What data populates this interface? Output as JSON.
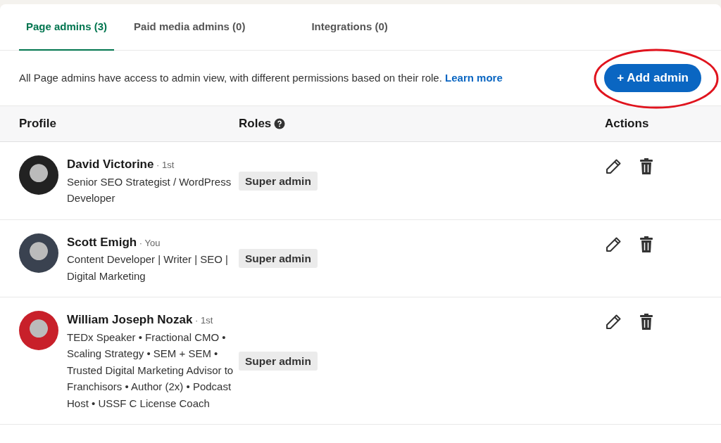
{
  "tabs": [
    {
      "label": "Page admins (3)",
      "selected": true
    },
    {
      "label": "Paid media admins (0)",
      "selected": false
    },
    {
      "label": "Integrations (0)",
      "selected": false
    }
  ],
  "info": {
    "text": "All Page admins have access to admin view, with different permissions based on their role.",
    "link": "Learn more"
  },
  "add_button": {
    "label": "+ Add admin",
    "highlighted": true
  },
  "table": {
    "columns": [
      "Profile",
      "Roles",
      "Actions"
    ],
    "rows": [
      {
        "name": "**David Victorine** · 1st",
        "headline": "Senior SEO Strategist / WordPress Developer",
        "role": "Super admin"
      },
      {
        "name": "**Scott Emigh** · You",
        "headline": "Content Developer | Writer | SEO | Digital Marketing",
        "role": "Super admin"
      },
      {
        "name": "**William Joseph Nozak** · 1st",
        "headline": "TEDx Speaker • Fractional CMO • Scaling Strategy • SEM + SEM • Trusted Digital Marketing Advisor to Franchisors • Author (2x) • Podcast Host • USSF C License Coach",
        "role": "Super admin"
      }
    ]
  }
}
